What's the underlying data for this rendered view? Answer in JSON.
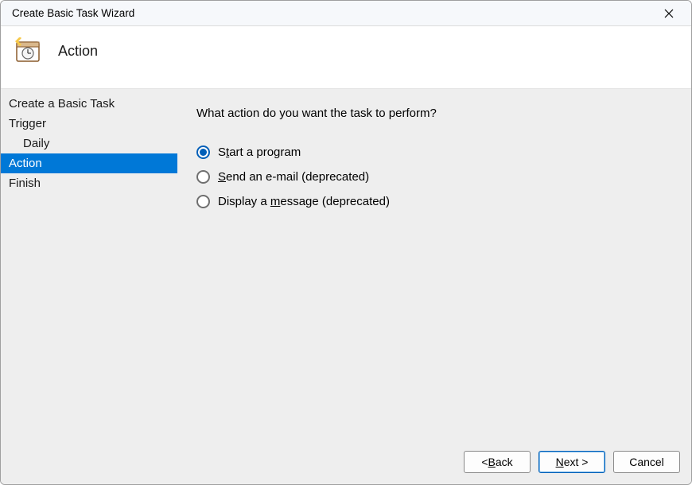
{
  "window": {
    "title": "Create Basic Task Wizard"
  },
  "header": {
    "page_title": "Action"
  },
  "sidebar": {
    "items": [
      {
        "label": "Create a Basic Task",
        "indent": false,
        "selected": false
      },
      {
        "label": "Trigger",
        "indent": false,
        "selected": false
      },
      {
        "label": "Daily",
        "indent": true,
        "selected": false
      },
      {
        "label": "Action",
        "indent": false,
        "selected": true
      },
      {
        "label": "Finish",
        "indent": false,
        "selected": false
      }
    ]
  },
  "content": {
    "prompt": "What action do you want the task to perform?",
    "options": [
      {
        "label_pre": "S",
        "accel": "t",
        "label_post": "art a program",
        "checked": true
      },
      {
        "label_pre": "",
        "accel": "S",
        "label_post": "end an e-mail (deprecated)",
        "checked": false
      },
      {
        "label_pre": "Display a ",
        "accel": "m",
        "label_post": "essage (deprecated)",
        "checked": false
      }
    ]
  },
  "footer": {
    "back_pre": "< ",
    "back_accel": "B",
    "back_post": "ack",
    "next_pre": "",
    "next_accel": "N",
    "next_post": "ext >",
    "cancel": "Cancel"
  }
}
